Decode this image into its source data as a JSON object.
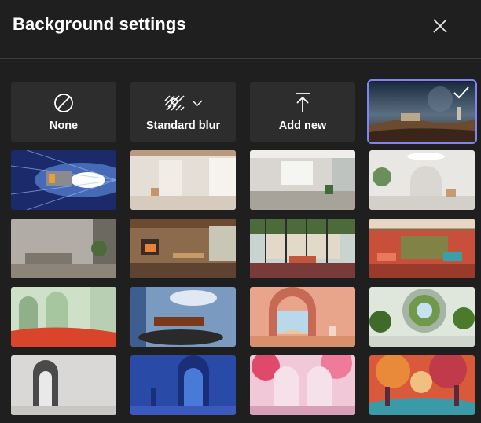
{
  "dialog": {
    "title": "Background settings",
    "close_icon": "close-icon"
  },
  "options": [
    {
      "id": "none",
      "label": "None",
      "icon": "prohibited-icon"
    },
    {
      "id": "blur",
      "label": "Standard blur",
      "icon": "blur-icon"
    },
    {
      "id": "add",
      "label": "Add new",
      "icon": "upload-arrow-icon"
    }
  ],
  "selected_background": "space-desert-landing",
  "backgrounds": [
    "space-desert-landing",
    "hyperspace-ship",
    "minimal-white-loft",
    "bright-open-office",
    "round-arch-white-room",
    "concrete-living-room",
    "wood-fireplace-lounge",
    "glass-terrace-pool",
    "coral-patio-plants",
    "green-arch-colonnade",
    "blue-circle-atrium",
    "pink-arch-desert",
    "round-portal-garden",
    "grey-arch-window",
    "blue-arch-doorway",
    "pink-tree-arches",
    "autumn-fantasy-forest"
  ],
  "colors": {
    "accent": "#7f85f5",
    "background": "#1f1f1f",
    "tile": "#2d2d2d"
  }
}
